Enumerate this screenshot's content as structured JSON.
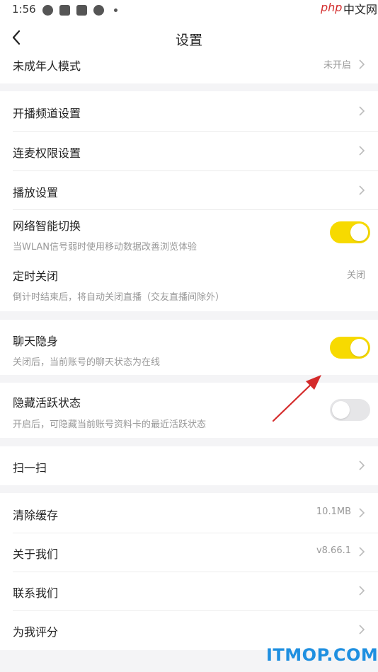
{
  "status_bar": {
    "time": "1:56"
  },
  "watermark_top": {
    "php": "php",
    "cn": "中文网"
  },
  "header": {
    "title": "设置"
  },
  "rows": {
    "minor_mode": {
      "title": "未成年人模式",
      "value": "未开启"
    },
    "channel_settings": {
      "title": "开播频道设置"
    },
    "mic_permission": {
      "title": "连麦权限设置"
    },
    "playback": {
      "title": "播放设置"
    },
    "network_switch": {
      "title": "网络智能切换",
      "subtitle": "当WLAN信号弱时使用移动数据改善浏览体验",
      "enabled": true
    },
    "timer_close": {
      "title": "定时关闭",
      "subtitle": "倒计时结束后，将自动关闭直播（交友直播间除外）",
      "value": "关闭"
    },
    "chat_invisible": {
      "title": "聊天隐身",
      "subtitle": "关闭后，当前账号的聊天状态为在线",
      "enabled": true
    },
    "hide_activity": {
      "title": "隐藏活跃状态",
      "subtitle": "开启后，可隐藏当前账号资料卡的最近活跃状态",
      "enabled": false
    },
    "scan": {
      "title": "扫一扫"
    },
    "clear_cache": {
      "title": "清除缓存",
      "value": "10.1MB"
    },
    "about": {
      "title": "关于我们",
      "value": "v8.66.1"
    },
    "contact": {
      "title": "联系我们"
    },
    "rate": {
      "title": "为我评分"
    }
  },
  "watermark_bottom": "ITMOP.COM",
  "colors": {
    "toggle_on": "#f7da00",
    "toggle_off": "#e6e6e8",
    "background": "#f4f4f6",
    "annotation_arrow": "#d42a2a"
  }
}
